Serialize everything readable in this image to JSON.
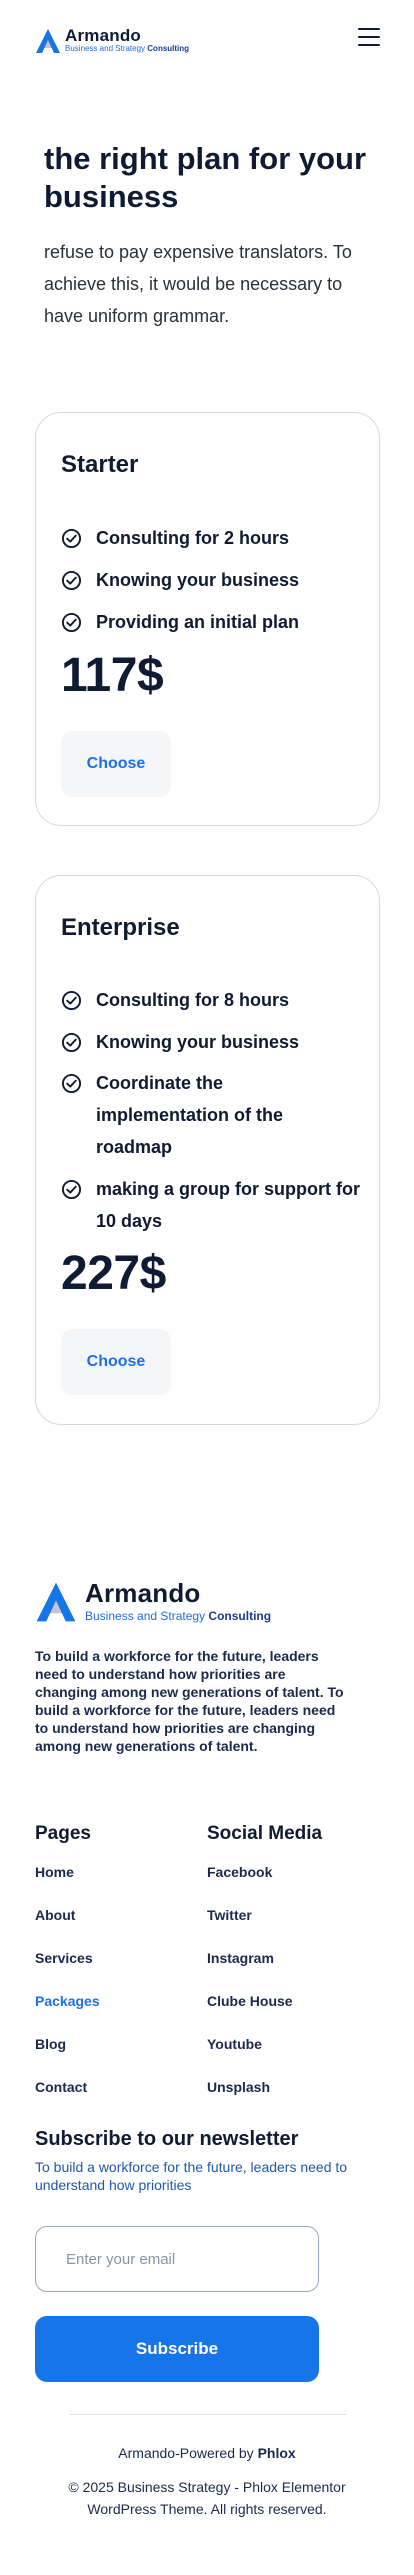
{
  "brand": {
    "name": "Armando",
    "tagline_prefix": "Business and Strategy",
    "tagline_bold": "Consulting"
  },
  "hero": {
    "title": "the right plan for your business",
    "text": "refuse to pay expensive translators. To achieve this, it would be necessary to have uniform grammar."
  },
  "plans": [
    {
      "name": "Starter",
      "features": [
        "Consulting for 2 hours",
        "Knowing your business",
        "Providing an initial plan"
      ],
      "price": "117$",
      "button": "Choose"
    },
    {
      "name": "Enterprise",
      "features": [
        "Consulting for 8 hours",
        "Knowing your business",
        "Coordinate the implementation of the roadmap",
        "making a group for support for 10 days"
      ],
      "price": "227$",
      "button": "Choose"
    }
  ],
  "footer": {
    "about": "To build a workforce for the future, leaders need to understand how priorities are changing among new generations of talent. To build a workforce for the future, leaders need to understand how priorities are changing among new generations of talent.",
    "pages_title": "Pages",
    "pages": [
      "Home",
      "About",
      "Services",
      "Packages",
      "Blog",
      "Contact"
    ],
    "active_page": "Packages",
    "social_title": "Social Media",
    "social": [
      "Facebook",
      "Twitter",
      "Instagram",
      "Clube House",
      "Youtube",
      "Unsplash"
    ],
    "newsletter_title": "Subscribe to our newsletter",
    "newsletter_text": "To build a workforce for the future, leaders need to understand how priorities",
    "email_placeholder": "Enter your email",
    "subscribe_label": "Subscribe",
    "powered_prefix": "Armando-Powered by",
    "powered_brand": "Phlox",
    "copyright": "© 2025 Business Strategy - Phlox Elementor WordPress Theme. All rights reserved."
  },
  "colors": {
    "accent": "#1675e8",
    "text": "#0f1b33"
  },
  "icons": {
    "menu": "hamburger-menu-icon",
    "check": "check-circle-icon",
    "logo": "brand-logo-icon"
  }
}
